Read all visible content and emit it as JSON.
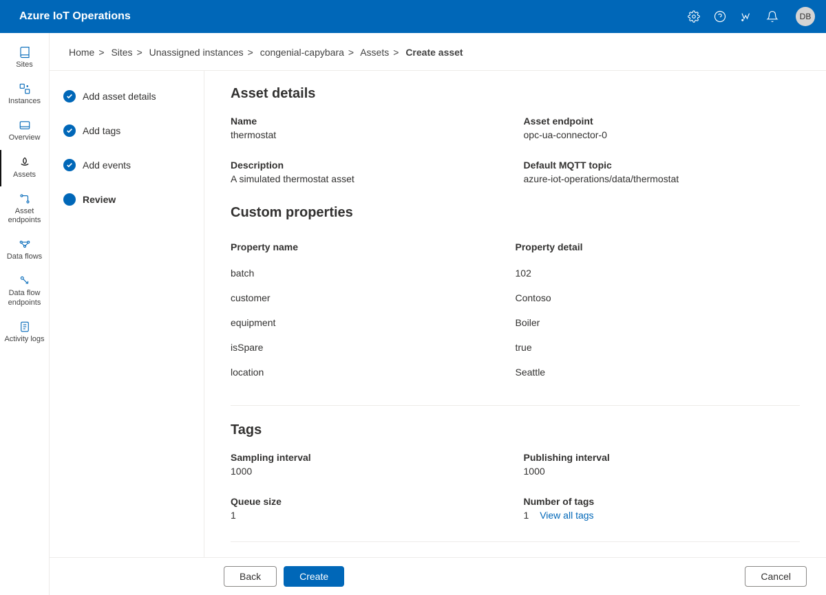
{
  "header": {
    "title": "Azure IoT Operations",
    "avatar": "DB"
  },
  "sidebar": {
    "items": [
      {
        "label": "Sites"
      },
      {
        "label": "Instances"
      },
      {
        "label": "Overview"
      },
      {
        "label": "Assets"
      },
      {
        "label": "Asset endpoints"
      },
      {
        "label": "Data flows"
      },
      {
        "label": "Data flow endpoints"
      },
      {
        "label": "Activity logs"
      }
    ]
  },
  "breadcrumb": {
    "items": [
      "Home",
      "Sites",
      "Unassigned instances",
      "congenial-capybara",
      "Assets"
    ],
    "current": "Create asset"
  },
  "wizard": {
    "steps": [
      {
        "label": "Add asset details"
      },
      {
        "label": "Add tags"
      },
      {
        "label": "Add events"
      },
      {
        "label": "Review"
      }
    ]
  },
  "sections": {
    "asset_details": {
      "heading": "Asset details",
      "name_label": "Name",
      "name_value": "thermostat",
      "endpoint_label": "Asset endpoint",
      "endpoint_value": "opc-ua-connector-0",
      "description_label": "Description",
      "description_value": "A simulated thermostat asset",
      "mqtt_label": "Default MQTT topic",
      "mqtt_value": "azure-iot-operations/data/thermostat"
    },
    "custom_props": {
      "heading": "Custom properties",
      "col_name": "Property name",
      "col_detail": "Property detail",
      "rows": [
        {
          "name": "batch",
          "detail": "102"
        },
        {
          "name": "customer",
          "detail": "Contoso"
        },
        {
          "name": "equipment",
          "detail": "Boiler"
        },
        {
          "name": "isSpare",
          "detail": "true"
        },
        {
          "name": "location",
          "detail": "Seattle"
        }
      ]
    },
    "tags": {
      "heading": "Tags",
      "sampling_label": "Sampling interval",
      "sampling_value": "1000",
      "publishing_label": "Publishing interval",
      "publishing_value": "1000",
      "queue_label": "Queue size",
      "queue_value": "1",
      "numtags_label": "Number of tags",
      "numtags_value": "1",
      "view_all_link": "View all tags"
    }
  },
  "buttons": {
    "back": "Back",
    "create": "Create",
    "cancel": "Cancel"
  }
}
